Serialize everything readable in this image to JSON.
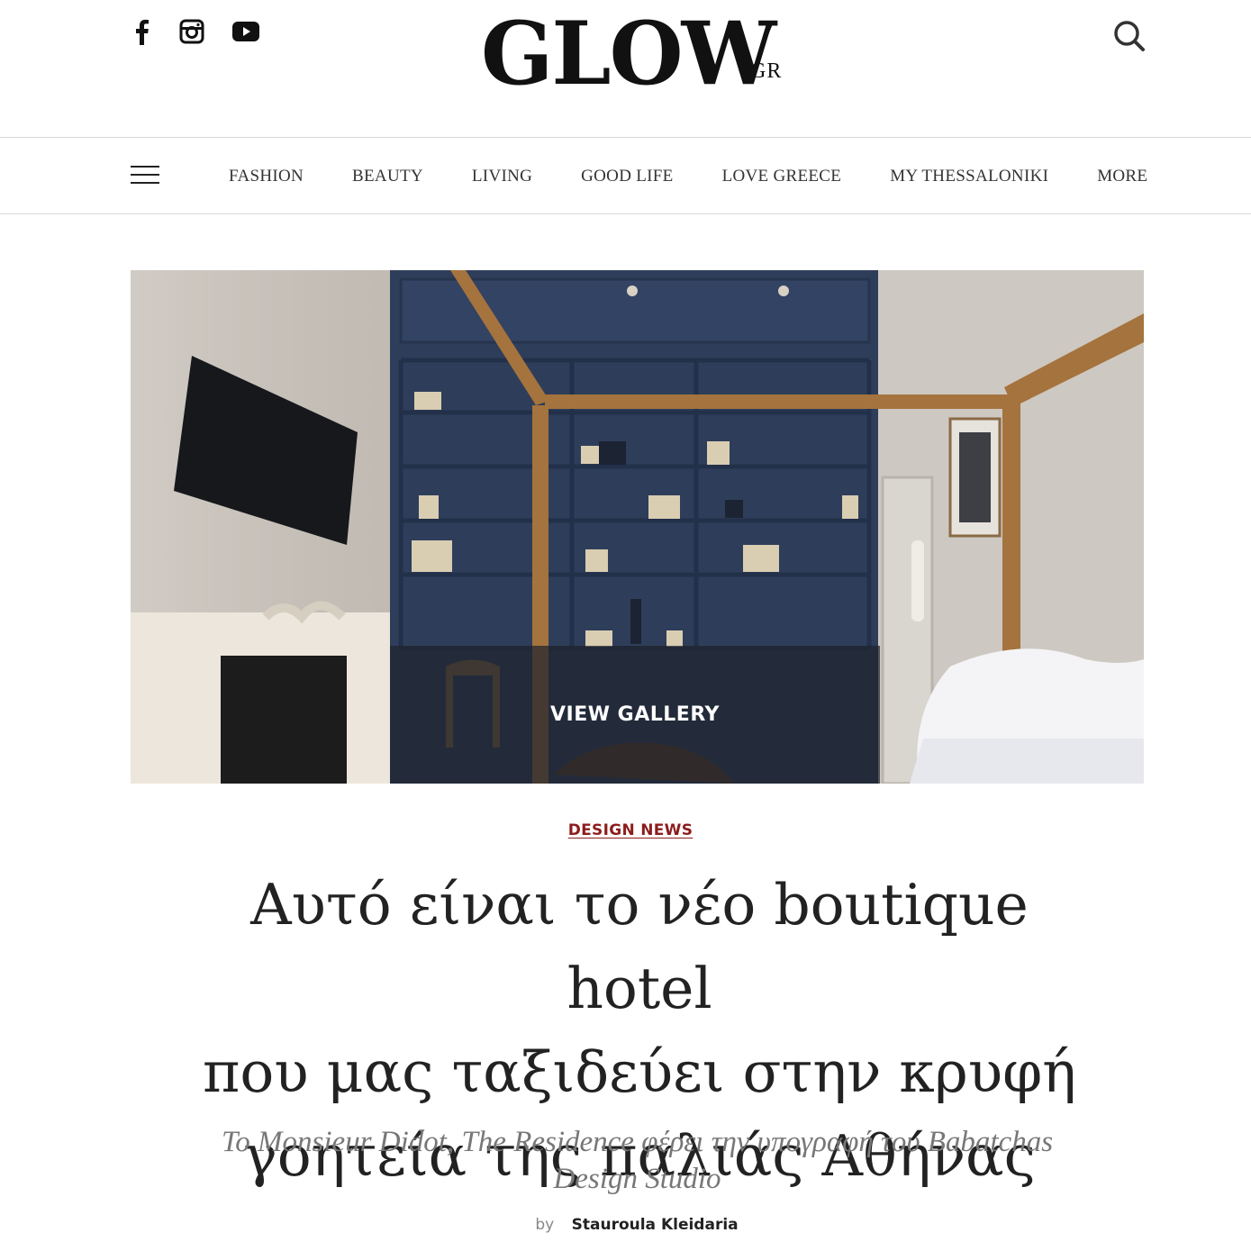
{
  "header": {
    "logo_main": "GLOW",
    "logo_suffix": ".GR",
    "social_icons": [
      "facebook-icon",
      "instagram-icon",
      "youtube-icon"
    ],
    "search_icon": "search-icon"
  },
  "nav": {
    "menu_icon": "hamburger-icon",
    "items": [
      "FASHION",
      "BEAUTY",
      "LIVING",
      "GOOD LIFE",
      "LOVE GREECE",
      "MY THESSALONIKI",
      "MORE"
    ]
  },
  "hero": {
    "gallery_label": "VIEW GALLERY"
  },
  "article": {
    "category": "DESIGN NEWS",
    "title_lines": [
      "Αυτό είναι το νέο boutique hotel",
      "που μας ταξιδεύει στην κρυφή",
      "γοητεία της παλιάς Αθήνας"
    ],
    "subtitle_lines": [
      "Το Monsieur Didot, The Residence φέρει την υπογραφή του Babatchas",
      "Design Studio"
    ],
    "byline_prefix": "by",
    "author": "Stauroula Kleidaria"
  },
  "colors": {
    "category": "#8c1d1d",
    "text": "#222222",
    "subtitle": "#777777",
    "divider": "#d9d9d9"
  }
}
